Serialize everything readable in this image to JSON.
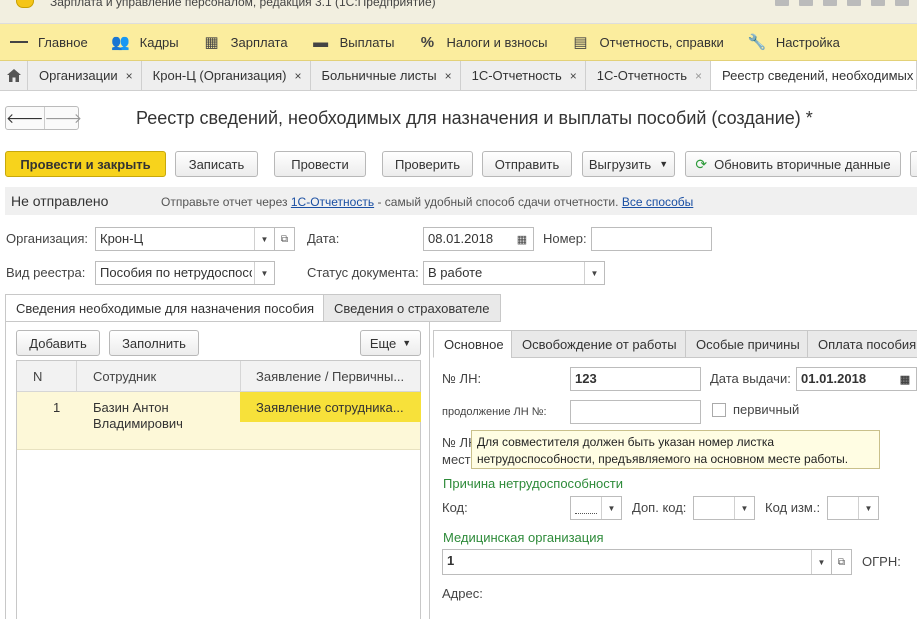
{
  "window": {
    "title": "Зарплата и управление персоналом, редакция 3.1  (1С:Предприятие)"
  },
  "main_menu": [
    {
      "label": "Главное",
      "icon": "hamburger-icon"
    },
    {
      "label": "Кадры",
      "icon": "people-icon"
    },
    {
      "label": "Зарплата",
      "icon": "calculator-icon"
    },
    {
      "label": "Выплаты",
      "icon": "wallet-icon"
    },
    {
      "label": "Налоги и взносы",
      "icon": "percent-icon"
    },
    {
      "label": "Отчетность, справки",
      "icon": "report-icon"
    },
    {
      "label": "Настройка",
      "icon": "wrench-icon"
    }
  ],
  "window_tabs": [
    {
      "label": "Организации",
      "close": "×"
    },
    {
      "label": "Крон-Ц (Организация)",
      "close": "×"
    },
    {
      "label": "Больничные листы",
      "close": "×"
    },
    {
      "label": "1С-Отчетность",
      "close": "×"
    },
    {
      "label": "1С-Отчетность",
      "close": "×"
    },
    {
      "label": "Реестр сведений, необходимых для назначения и выплаты пособий (создание) *",
      "close": ""
    }
  ],
  "nav": {
    "back": "🡐",
    "forward": "🡒"
  },
  "document": {
    "title": "Реестр сведений, необходимых для назначения и выплаты пособий (создание) *"
  },
  "toolbar": {
    "post_close": "Провести и закрыть",
    "save": "Записать",
    "post": "Провести",
    "check": "Проверить",
    "send": "Отправить",
    "export": "Выгрузить",
    "refresh": "Обновить вторичные данные"
  },
  "status": {
    "state": "Не отправлено",
    "hint_prefix": "Отправьте отчет через",
    "hint_link": "1С-Отчетность",
    "hint_suffix": "- самый удобный способ сдачи отчетности.",
    "all_ways": "Все способы"
  },
  "form": {
    "org_label": "Организация:",
    "org_value": "Крон-Ц",
    "date_label": "Дата:",
    "date_value": "08.01.2018",
    "number_label": "Номер:",
    "number_value": "",
    "registry_label": "Вид реестра:",
    "registry_value": "Пособия по нетрудоспособ",
    "doc_status_label": "Статус документа:",
    "doc_status_value": "В работе"
  },
  "page_tabs": [
    {
      "label": "Сведения необходимые для назначения пособия",
      "active": true
    },
    {
      "label": "Сведения о страхователе",
      "active": false
    }
  ],
  "list_toolbar": {
    "add": "Добавить",
    "fill": "Заполнить",
    "more": "Еще"
  },
  "table": {
    "columns": [
      "N",
      "Сотрудник",
      "Заявление / Первичны..."
    ],
    "rows": [
      {
        "n": "1",
        "employee_line1": "Базин Антон",
        "employee_line2": "Владимирович",
        "statement": "Заявление сотрудника..."
      }
    ]
  },
  "right_tabs": [
    {
      "label": "Основное",
      "active": true
    },
    {
      "label": "Освобождение от работы",
      "active": false
    },
    {
      "label": "Особые причины",
      "active": false
    },
    {
      "label": "Оплата пособия",
      "active": false
    }
  ],
  "sick_leave": {
    "ln_label": "№ ЛН:",
    "ln_value": "123",
    "issue_date_label": "Дата выдачи:",
    "issue_date_value": "01.01.2018",
    "continuation_label": "продолжение ЛН №:",
    "continuation_value": "",
    "primary_label": "первичный",
    "primary_checked": false,
    "main_job_label_1": "№ ЛН",
    "main_job_label_2": "мест",
    "cause_section": "Причина нетрудоспособности",
    "code_label": "Код:",
    "code_value": "",
    "add_code_label": "Доп. код:",
    "add_code_value": "",
    "change_code_label": "Код изм.:",
    "change_code_value": "",
    "med_org_section": "Медицинская организация",
    "med_org_value": "1",
    "ogrn_label": "ОГРН:",
    "address_label": "Адрес:"
  },
  "tooltip": {
    "line1": "Для совместителя должен быть указан номер листка",
    "line2": "нетрудоспособности, предъявляемого на основном месте работы."
  },
  "colors": {
    "menu_bg": "#fbed9e",
    "primary_button": "#f7d31c",
    "selected_row": "#fdf8d8",
    "selected_cell": "#f7e13a",
    "section_header": "#2e8b3a",
    "link": "#1a4fa3"
  }
}
